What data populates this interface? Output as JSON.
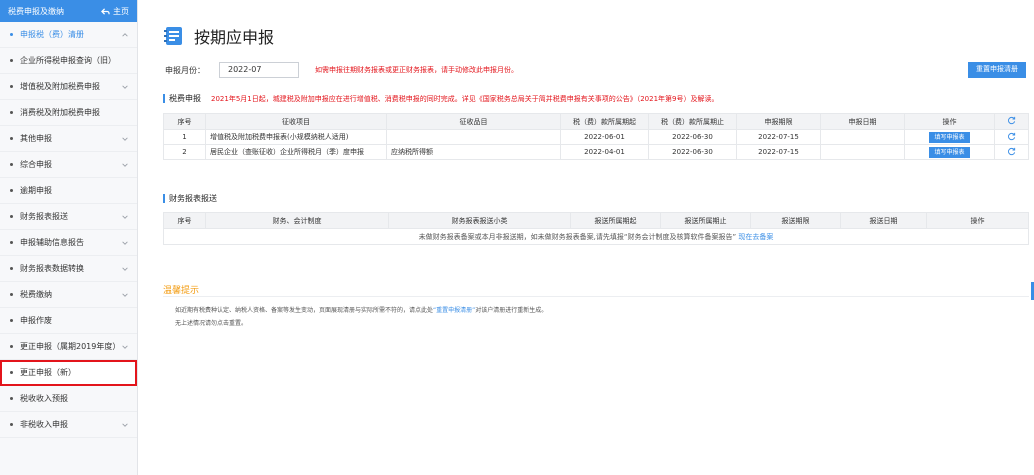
{
  "sidebar": {
    "header_title": "税费申报及缴纳",
    "home_label": "主页",
    "items": [
      {
        "label": "申报税（费）清册",
        "active": true,
        "chevron": "up"
      },
      {
        "label": "企业所得税申报查询（旧）",
        "sub": true
      },
      {
        "label": "增值税及附加税费申报",
        "chevron": "down"
      },
      {
        "label": "消费税及附加税费申报"
      },
      {
        "label": "其他申报",
        "chevron": "down"
      },
      {
        "label": "综合申报",
        "chevron": "down"
      },
      {
        "label": "逾期申报"
      },
      {
        "label": "财务报表报送",
        "chevron": "down"
      },
      {
        "label": "申报辅助信息报告",
        "chevron": "down"
      },
      {
        "label": "财务报表数据转换",
        "chevron": "down"
      },
      {
        "label": "税费缴纳",
        "chevron": "down"
      },
      {
        "label": "申报作废"
      },
      {
        "label": "更正申报（属期2019年度）",
        "chevron": "down"
      },
      {
        "label": "更正申报（新）",
        "highlight": true
      },
      {
        "label": "税收收入预报"
      },
      {
        "label": "非税收入申报",
        "chevron": "down"
      }
    ]
  },
  "page": {
    "title": "按期应申报",
    "period_label": "申报月份：",
    "period_value": "2022-07",
    "period_hint": "如需申报往期财务报表或更正财务报表，请手动修改此申报月份。",
    "redo_button": "重置申报清册"
  },
  "tax_section": {
    "title": "税费申报",
    "notice": "2021年5月1日起，城建税及附加申报应在进行增值税、消费税申报的同时完成。详见《国家税务总局关于简并税费申报有关事项的公告》（2021年第9号）及解读。",
    "headers": [
      "序号",
      "征收项目",
      "征收品目",
      "税（费）款所属期起",
      "税（费）款所属期止",
      "申报期限",
      "申报日期",
      "操作"
    ],
    "rows": [
      {
        "no": "1",
        "item": "增值税及附加税费申报表(小规模纳税人适用)",
        "subitem": "",
        "start": "2022-06-01",
        "end": "2022-06-30",
        "deadline": "2022-07-15",
        "date": "",
        "action": "填写申报表"
      },
      {
        "no": "2",
        "item": "居民企业（查账征收）企业所得税月（季）度申报",
        "subitem": "应纳税所得额",
        "start": "2022-04-01",
        "end": "2022-06-30",
        "deadline": "2022-07-15",
        "date": "",
        "action": "填写申报表"
      }
    ]
  },
  "finance_section": {
    "title": "财务报表报送",
    "headers": [
      "序号",
      "财务、会计制度",
      "财务报表报送小类",
      "报送所属期起",
      "报送所属期止",
      "报送期限",
      "报送日期",
      "操作"
    ],
    "empty_text": "未做财务报表备案或本月非报送期，如未做财务报表备案,请先填报“财务会计制度及核算软件备案报告”",
    "empty_link": "现在去备案"
  },
  "warm": {
    "title": "温馨提示",
    "line1_before": "如近期有税费种认定、纳税人资格、备案等发生变动，页面展现清册与实际所需不符的，请点此处",
    "line1_link": "“重置申报清册”",
    "line1_after": "对该户清册进行重新生成。",
    "line2": "无上述情况请勿点击重置。"
  },
  "colors": {
    "accent": "#3a8ee6",
    "warning": "#e3141b",
    "tip": "#f39c12"
  }
}
